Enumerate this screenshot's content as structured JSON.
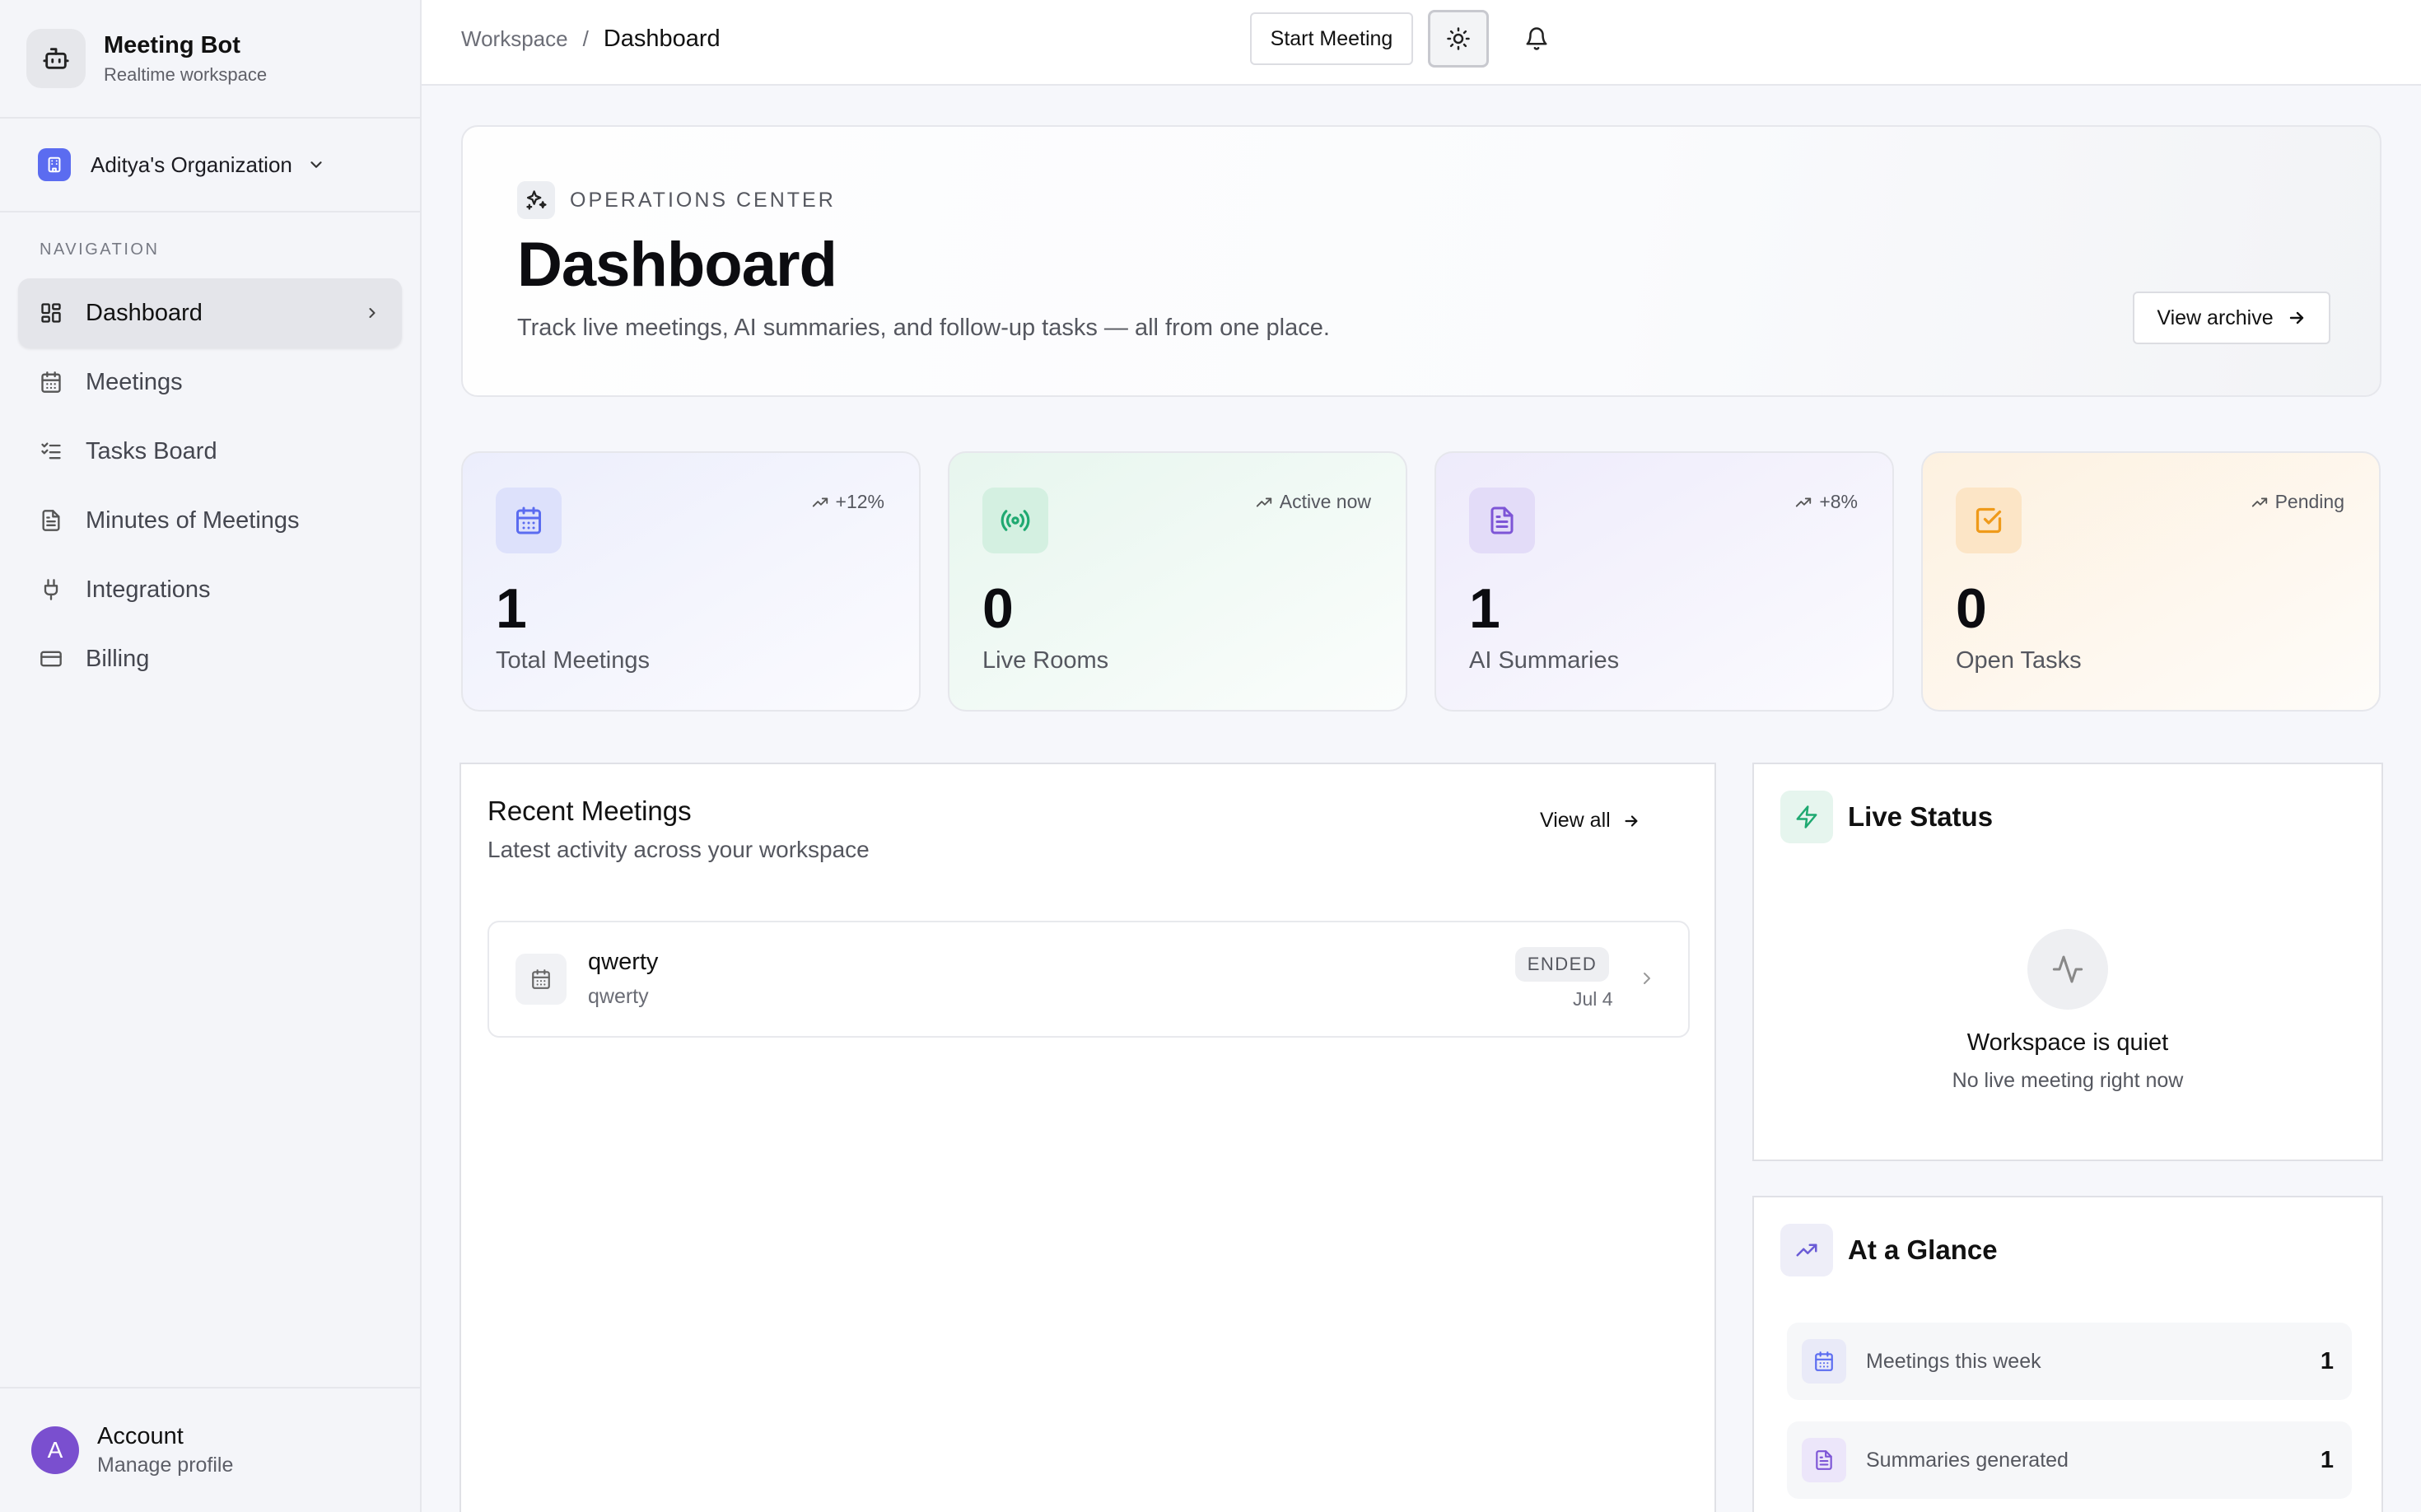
{
  "brand": {
    "name": "Meeting Bot",
    "subtitle": "Realtime workspace"
  },
  "org": {
    "name": "Aditya's Organization"
  },
  "nav": {
    "heading": "NAVIGATION",
    "items": [
      {
        "label": "Dashboard",
        "icon": "grid-icon",
        "active": true
      },
      {
        "label": "Meetings",
        "icon": "calendar-icon"
      },
      {
        "label": "Tasks Board",
        "icon": "checklist-icon"
      },
      {
        "label": "Minutes of Meetings",
        "icon": "document-icon"
      },
      {
        "label": "Integrations",
        "icon": "plug-icon"
      },
      {
        "label": "Billing",
        "icon": "credit-card-icon"
      }
    ]
  },
  "account": {
    "initial": "A",
    "name": "Account",
    "subtitle": "Manage profile"
  },
  "topbar": {
    "breadcrumb": [
      "Workspace",
      "Dashboard"
    ],
    "start_meeting": "Start Meeting"
  },
  "hero": {
    "tag": "OPERATIONS CENTER",
    "title": "Dashboard",
    "subtitle": "Track live meetings, AI summaries, and follow-up tasks — all from one place.",
    "archive_button": "View archive"
  },
  "stats": [
    {
      "value": "1",
      "label": "Total Meetings",
      "trend": "+12%",
      "icon": "calendar-icon",
      "accent": "#5b6cf0"
    },
    {
      "value": "0",
      "label": "Live Rooms",
      "trend": "Active now",
      "icon": "broadcast-icon",
      "accent": "#1fa971"
    },
    {
      "value": "1",
      "label": "AI Summaries",
      "trend": "+8%",
      "icon": "document-icon",
      "accent": "#7d55d6"
    },
    {
      "value": "0",
      "label": "Open Tasks",
      "trend": "Pending",
      "icon": "check-square-icon",
      "accent": "#ef9a1a"
    }
  ],
  "recent": {
    "title": "Recent Meetings",
    "subtitle": "Latest activity across your workspace",
    "view_all": "View all",
    "meetings": [
      {
        "title": "qwerty",
        "subtitle": "qwerty",
        "status": "ENDED",
        "date": "Jul 4"
      }
    ]
  },
  "live_status": {
    "title": "Live Status",
    "empty_title": "Workspace is quiet",
    "empty_subtitle": "No live meeting right now"
  },
  "glance": {
    "title": "At a Glance",
    "rows": [
      {
        "label": "Meetings this week",
        "value": "1",
        "icon": "calendar-icon"
      },
      {
        "label": "Summaries generated",
        "value": "1",
        "icon": "document-icon"
      }
    ]
  }
}
